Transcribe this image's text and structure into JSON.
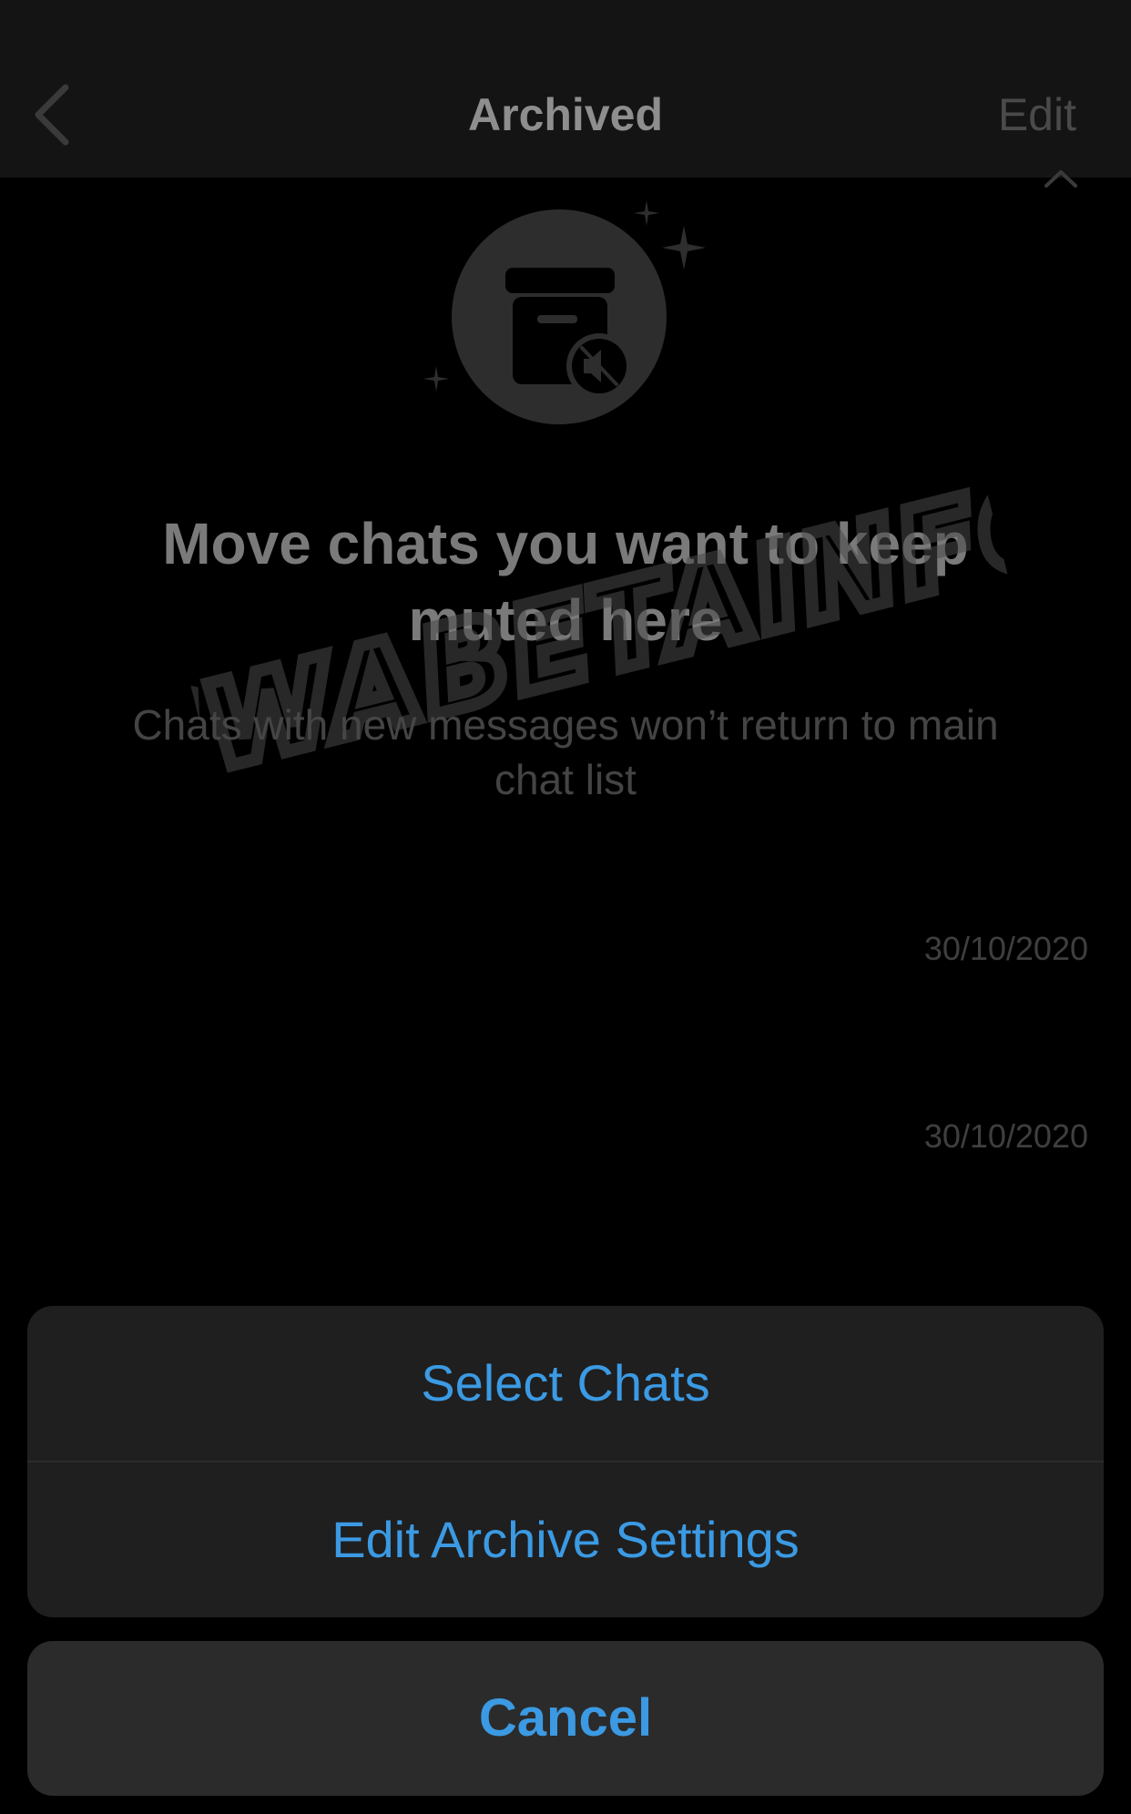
{
  "header": {
    "title": "Archived",
    "edit_label": "Edit",
    "back_icon": "chevron-left-icon"
  },
  "empty_state": {
    "title": "Move chats you want to keep muted here",
    "subtitle": "Chats with new messages won’t return to main chat list",
    "illustration_icon": "archive-box-muted-icon"
  },
  "watermark": {
    "text": "CWABETAINFO"
  },
  "chats": [
    {
      "date": "30/10/2020"
    },
    {
      "date": "30/10/2020"
    }
  ],
  "action_sheet": {
    "items": [
      {
        "label": "Select Chats"
      },
      {
        "label": "Edit Archive Settings"
      }
    ],
    "cancel_label": "Cancel"
  },
  "colors": {
    "accent": "#3b9ae3",
    "background": "#000000",
    "sheet": "#1f1f1f",
    "cancel_bg": "#2b2b2b"
  }
}
